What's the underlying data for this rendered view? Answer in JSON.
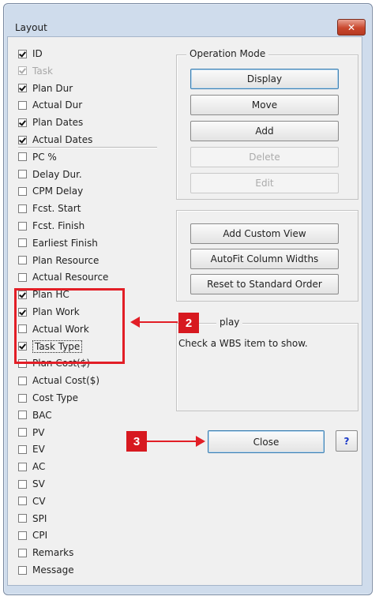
{
  "window": {
    "title": "Layout",
    "close_glyph": "✕"
  },
  "columns": [
    {
      "label": "ID",
      "checked": true,
      "enabled": true
    },
    {
      "label": "Task",
      "checked": true,
      "enabled": false
    },
    {
      "label": "Plan Dur",
      "checked": true,
      "enabled": true
    },
    {
      "label": "Actual Dur",
      "checked": false,
      "enabled": true
    },
    {
      "label": "Plan Dates",
      "checked": true,
      "enabled": true
    },
    {
      "label": "Actual Dates",
      "checked": true,
      "enabled": true
    },
    {
      "label": "PC %",
      "checked": false,
      "enabled": true
    },
    {
      "label": "Delay Dur.",
      "checked": false,
      "enabled": true
    },
    {
      "label": "CPM Delay",
      "checked": false,
      "enabled": true
    },
    {
      "label": "Fcst. Start",
      "checked": false,
      "enabled": true
    },
    {
      "label": "Fcst. Finish",
      "checked": false,
      "enabled": true
    },
    {
      "label": "Earliest Finish",
      "checked": false,
      "enabled": true
    },
    {
      "label": "Plan Resource",
      "checked": false,
      "enabled": true
    },
    {
      "label": "Actual Resource",
      "checked": false,
      "enabled": true
    },
    {
      "label": "Plan HC",
      "checked": true,
      "enabled": true
    },
    {
      "label": "Plan Work",
      "checked": true,
      "enabled": true
    },
    {
      "label": "Actual Work",
      "checked": false,
      "enabled": true
    },
    {
      "label": "Task Type",
      "checked": true,
      "enabled": true
    },
    {
      "label": "Plan Cost($)",
      "checked": false,
      "enabled": true
    },
    {
      "label": "Actual Cost($)",
      "checked": false,
      "enabled": true
    },
    {
      "label": "Cost Type",
      "checked": false,
      "enabled": true
    },
    {
      "label": "BAC",
      "checked": false,
      "enabled": true
    },
    {
      "label": "PV",
      "checked": false,
      "enabled": true
    },
    {
      "label": "EV",
      "checked": false,
      "enabled": true
    },
    {
      "label": "AC",
      "checked": false,
      "enabled": true
    },
    {
      "label": "SV",
      "checked": false,
      "enabled": true
    },
    {
      "label": "CV",
      "checked": false,
      "enabled": true
    },
    {
      "label": "SPI",
      "checked": false,
      "enabled": true
    },
    {
      "label": "CPI",
      "checked": false,
      "enabled": true
    },
    {
      "label": "Remarks",
      "checked": false,
      "enabled": true
    },
    {
      "label": "Message",
      "checked": false,
      "enabled": true
    }
  ],
  "operation_mode": {
    "label": "Operation Mode",
    "buttons": [
      {
        "label": "Display",
        "enabled": true
      },
      {
        "label": "Move",
        "enabled": true
      },
      {
        "label": "Add",
        "enabled": true
      },
      {
        "label": "Delete",
        "enabled": false
      },
      {
        "label": "Edit",
        "enabled": false
      }
    ]
  },
  "view_buttons": [
    {
      "label": "Add Custom View"
    },
    {
      "label": "AutoFit Column Widths"
    },
    {
      "label": "Reset to Standard Order"
    }
  ],
  "display_group": {
    "label": "play",
    "message": "Check a WBS item to show."
  },
  "footer": {
    "close_label": "Close",
    "help_label": "?"
  },
  "annotations": {
    "badge_2": "2",
    "badge_3": "3",
    "accent_color": "#e21e26"
  }
}
